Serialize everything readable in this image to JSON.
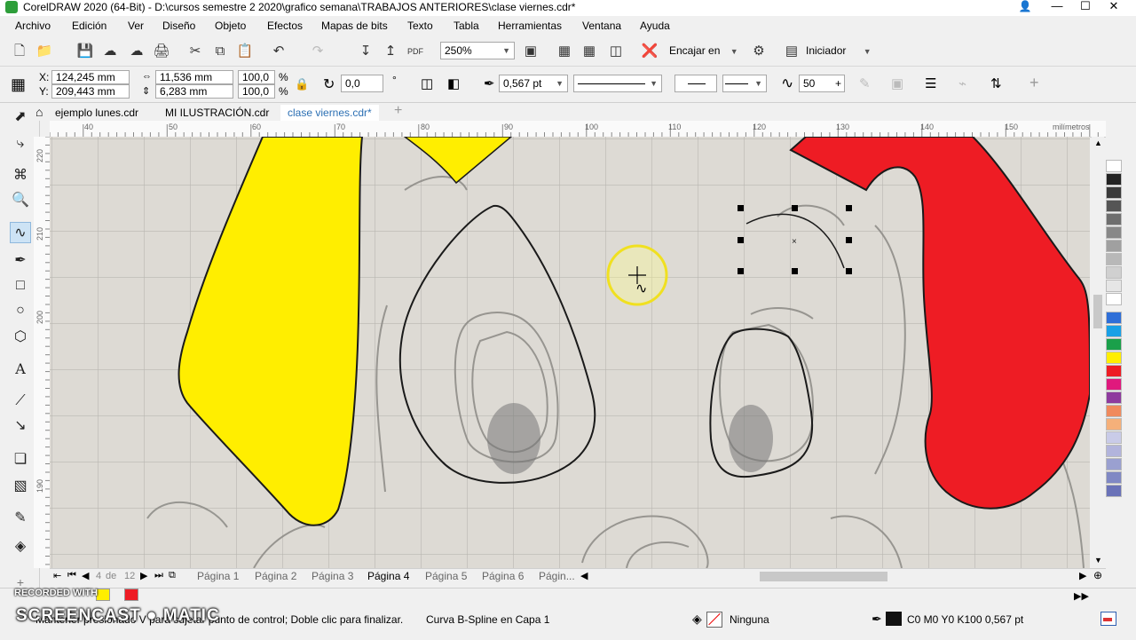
{
  "window": {
    "title": "CorelDRAW 2020 (64-Bit) - D:\\cursos semestre 2 2020\\grafico semana\\TRABAJOS ANTERIORES\\clase viernes.cdr*",
    "controls": [
      "—",
      "☐",
      "✕"
    ]
  },
  "menubar": [
    "Archivo",
    "Edición",
    "Ver",
    "Diseño",
    "Objeto",
    "Efectos",
    "Mapas de bits",
    "Texto",
    "Tabla",
    "Herramientas",
    "Ventana",
    "Ayuda"
  ],
  "toolbar": {
    "zoom": "250%",
    "snap_label": "Encajar en",
    "workspace_label": "Iniciador"
  },
  "propbar": {
    "x_label": "X:",
    "x_value": "124,245 mm",
    "y_label": "Y:",
    "y_value": "209,443 mm",
    "w_value": "11,536 mm",
    "h_value": "6,283 mm",
    "scale_w": "100,0",
    "scale_h": "100,0",
    "percent": "%",
    "rotation": "0,0",
    "degree": "°",
    "outline_width": "0,567 pt",
    "smoothing": "50"
  },
  "doc_tabs": [
    "ejemplo lunes.cdr",
    "MI ILUSTRACIÓN.cdr",
    "clase viernes.cdr*"
  ],
  "active_doc_tab": 2,
  "ruler": {
    "h_ticks": [
      "40",
      "50",
      "60",
      "70",
      "80",
      "90",
      "100",
      "110",
      "120",
      "130",
      "140",
      "150"
    ],
    "unit": "milímetros",
    "v_ticks": [
      "220",
      "210",
      "200",
      "190"
    ]
  },
  "pages": {
    "current": "4",
    "of": "de",
    "total": "12",
    "tabs": [
      "Página 1",
      "Página 2",
      "Página 3",
      "Página 4",
      "Página 5",
      "Página 6",
      "Págin..."
    ],
    "active_tab": 3
  },
  "status": {
    "hint": "Mantener presionado V para sujetar punto de control; Doble clic para finalizar.",
    "object": "Curva B-Spline en Capa 1",
    "fill": "Ninguna",
    "outline": "C0 M0 Y0 K100  0,567 pt"
  },
  "watermark": {
    "recorded": "RECORDED WITH",
    "brand": "SCREENCAST ● MATIC"
  },
  "colors": {
    "yellow": "#ffee00",
    "red": "#ee1c24",
    "accent_tab": "#2b6fb3"
  },
  "palette": [
    "#ffffff",
    "#222222",
    "#3a3a3a",
    "#555555",
    "#6e6e6e",
    "#888888",
    "#a0a0a0",
    "#b8b8b8",
    "#d0d0d0",
    "#e6e6e6",
    "#ffffff",
    "#2f6fd8",
    "#19a0e6",
    "#1aa04a",
    "#ffee00",
    "#ee1c24",
    "#e0197d",
    "#8e3b9e",
    "#f08a5d",
    "#f5b07a",
    "#c9cbe8",
    "#b2b4dc",
    "#9aa0d0",
    "#8088c4",
    "#6a72b8"
  ]
}
